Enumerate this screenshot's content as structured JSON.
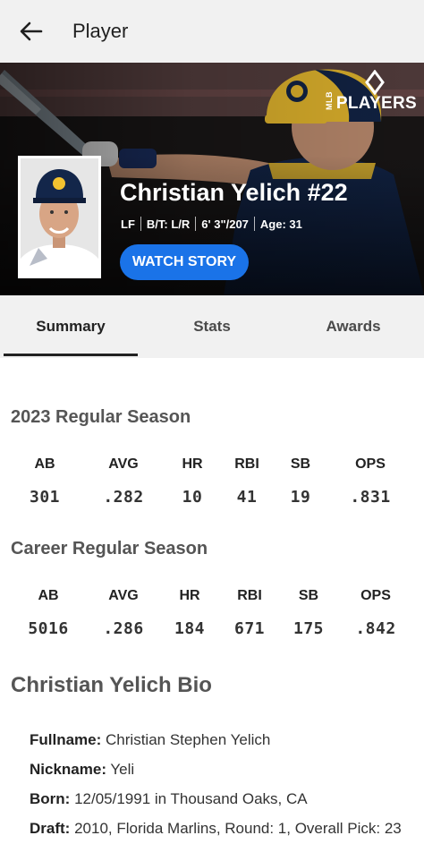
{
  "appbar": {
    "title": "Player",
    "back_icon": "arrow-left-icon"
  },
  "hero": {
    "brand_small": "MLB",
    "brand_large": "PLAYERS",
    "player_name": "Christian Yelich #22",
    "position": "LF",
    "bats_throws": "B/T: L/R",
    "height_weight": "6' 3\"/207",
    "age": "Age: 31",
    "watch_label": "WATCH STORY",
    "colors": {
      "button": "#1a73e8",
      "cap_gold": "#f2c230",
      "cap_navy": "#13264a"
    }
  },
  "tabs": [
    {
      "label": "Summary",
      "active": true
    },
    {
      "label": "Stats",
      "active": false
    },
    {
      "label": "Awards",
      "active": false
    }
  ],
  "season": {
    "title": "2023 Regular Season",
    "headers": [
      "AB",
      "AVG",
      "HR",
      "RBI",
      "SB",
      "OPS"
    ],
    "values": [
      "301",
      ".282",
      "10",
      "41",
      "19",
      ".831"
    ]
  },
  "career": {
    "title": "Career Regular Season",
    "headers": [
      "AB",
      "AVG",
      "HR",
      "RBI",
      "SB",
      "OPS"
    ],
    "values": [
      "5016",
      ".286",
      "184",
      "671",
      "175",
      ".842"
    ]
  },
  "bio": {
    "title": "Christian Yelich Bio",
    "items": [
      {
        "key": "Fullname:",
        "value": "Christian Stephen Yelich"
      },
      {
        "key": "Nickname:",
        "value": "Yeli"
      },
      {
        "key": "Born:",
        "value": "12/05/1991 in Thousand Oaks, CA"
      },
      {
        "key": "Draft:",
        "value": "2010, Florida Marlins, Round: 1, Overall Pick: 23"
      }
    ]
  }
}
